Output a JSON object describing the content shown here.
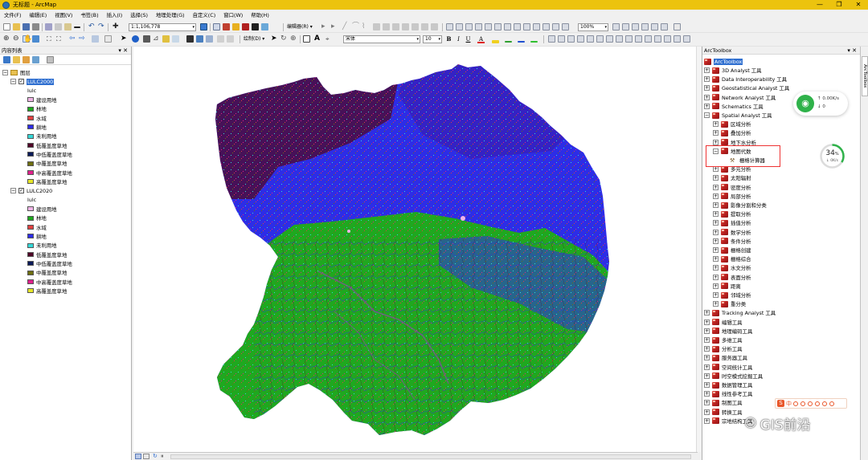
{
  "window": {
    "title": "无标题 - ArcMap",
    "minimize": "—",
    "maximize": "❐",
    "close": "✕"
  },
  "menu": [
    "文件(F)",
    "编辑(E)",
    "视图(V)",
    "书签(B)",
    "插入(I)",
    "选择(S)",
    "地理处理(G)",
    "自定义(C)",
    "窗口(W)",
    "帮助(H)"
  ],
  "toolbar": {
    "scale": "1:1,106,778",
    "editor_label": "编辑器(R) ▾",
    "zoom": "100%",
    "draw_label": "绘制(D) ▾",
    "font": "宋体",
    "font_size": "10",
    "bold": "B",
    "italic": "I",
    "underline": "U",
    "font_color_letter": "A"
  },
  "toc": {
    "title": "内容列表",
    "pin": "▾ ✕",
    "layers_group": "图层",
    "layers": [
      {
        "name": "LULC2000",
        "field": "lulc",
        "classes": [
          {
            "label": "建设用地",
            "color": "#f0b4e6"
          },
          {
            "label": "林地",
            "color": "#1fa81f"
          },
          {
            "label": "水域",
            "color": "#e04040"
          },
          {
            "label": "耕地",
            "color": "#2d2de6"
          },
          {
            "label": "未利用地",
            "color": "#35d8d8"
          },
          {
            "label": "低覆盖度草地",
            "color": "#500828"
          },
          {
            "label": "中低覆盖度草地",
            "color": "#0a1a58"
          },
          {
            "label": "中覆盖度草地",
            "color": "#6e6e10"
          },
          {
            "label": "中高覆盖度草地",
            "color": "#e0208c"
          },
          {
            "label": "高覆盖度草地",
            "color": "#e6e628"
          }
        ]
      },
      {
        "name": "LULC2020",
        "field": "lulc",
        "classes": [
          {
            "label": "建设用地",
            "color": "#f0b4e6"
          },
          {
            "label": "林地",
            "color": "#1fa81f"
          },
          {
            "label": "水域",
            "color": "#e04040"
          },
          {
            "label": "耕地",
            "color": "#2d2de6"
          },
          {
            "label": "未利用地",
            "color": "#35d8d8"
          },
          {
            "label": "低覆盖度草地",
            "color": "#500828"
          },
          {
            "label": "中低覆盖度草地",
            "color": "#0a1a58"
          },
          {
            "label": "中覆盖度草地",
            "color": "#6e6e10"
          },
          {
            "label": "中高覆盖度草地",
            "color": "#e0208c"
          },
          {
            "label": "高覆盖度草地",
            "color": "#e6e628"
          }
        ]
      }
    ]
  },
  "toolbox": {
    "title": "ArcToolbox",
    "pin": "▾ ✕",
    "root": "ArcToolbox",
    "items": [
      {
        "label": "3D Analyst 工具",
        "level": 0,
        "kind": "box",
        "expanded": false
      },
      {
        "label": "Data Interoperability 工具",
        "level": 0,
        "kind": "box",
        "expanded": false
      },
      {
        "label": "Geostatistical Analyst 工具",
        "level": 0,
        "kind": "box",
        "expanded": false
      },
      {
        "label": "Network Analyst 工具",
        "level": 0,
        "kind": "box",
        "expanded": false
      },
      {
        "label": "Schematics 工具",
        "level": 0,
        "kind": "box",
        "expanded": false
      },
      {
        "label": "Spatial Analyst 工具",
        "level": 0,
        "kind": "box",
        "expanded": true
      },
      {
        "label": "区域分析",
        "level": 1,
        "kind": "box",
        "expanded": false
      },
      {
        "label": "叠加分析",
        "level": 1,
        "kind": "box",
        "expanded": false
      },
      {
        "label": "地下水分析",
        "level": 1,
        "kind": "box",
        "expanded": false
      },
      {
        "label": "地图代数",
        "level": 1,
        "kind": "box",
        "expanded": true
      },
      {
        "label": "栅格计算器",
        "level": 2,
        "kind": "tool",
        "expanded": false
      },
      {
        "label": "多元分析",
        "level": 1,
        "kind": "box",
        "expanded": false
      },
      {
        "label": "太阳辐射",
        "level": 1,
        "kind": "box",
        "expanded": false
      },
      {
        "label": "密度分析",
        "level": 1,
        "kind": "box",
        "expanded": false
      },
      {
        "label": "局部分析",
        "level": 1,
        "kind": "box",
        "expanded": false
      },
      {
        "label": "影像分割和分类",
        "level": 1,
        "kind": "box",
        "expanded": false
      },
      {
        "label": "提取分析",
        "level": 1,
        "kind": "box",
        "expanded": false
      },
      {
        "label": "插值分析",
        "level": 1,
        "kind": "box",
        "expanded": false
      },
      {
        "label": "数学分析",
        "level": 1,
        "kind": "box",
        "expanded": false
      },
      {
        "label": "条件分析",
        "level": 1,
        "kind": "box",
        "expanded": false
      },
      {
        "label": "栅格创建",
        "level": 1,
        "kind": "box",
        "expanded": false
      },
      {
        "label": "栅格综合",
        "level": 1,
        "kind": "box",
        "expanded": false
      },
      {
        "label": "水文分析",
        "level": 1,
        "kind": "box",
        "expanded": false
      },
      {
        "label": "表面分析",
        "level": 1,
        "kind": "box",
        "expanded": false
      },
      {
        "label": "距离",
        "level": 1,
        "kind": "box",
        "expanded": false
      },
      {
        "label": "邻域分析",
        "level": 1,
        "kind": "box",
        "expanded": false
      },
      {
        "label": "重分类",
        "level": 1,
        "kind": "box",
        "expanded": false
      },
      {
        "label": "Tracking Analyst 工具",
        "level": 0,
        "kind": "box",
        "expanded": false
      },
      {
        "label": "编辑工具",
        "level": 0,
        "kind": "box",
        "expanded": false
      },
      {
        "label": "地理编码工具",
        "level": 0,
        "kind": "box",
        "expanded": false
      },
      {
        "label": "多维工具",
        "level": 0,
        "kind": "box",
        "expanded": false
      },
      {
        "label": "分析工具",
        "level": 0,
        "kind": "box",
        "expanded": false
      },
      {
        "label": "服务器工具",
        "level": 0,
        "kind": "box",
        "expanded": false
      },
      {
        "label": "空间统计工具",
        "level": 0,
        "kind": "box",
        "expanded": false
      },
      {
        "label": "时空模式挖掘工具",
        "level": 0,
        "kind": "box",
        "expanded": false
      },
      {
        "label": "数据管理工具",
        "level": 0,
        "kind": "box",
        "expanded": false
      },
      {
        "label": "线性参考工具",
        "level": 0,
        "kind": "box",
        "expanded": false
      },
      {
        "label": "制图工具",
        "level": 0,
        "kind": "box",
        "expanded": false
      },
      {
        "label": "转换工具",
        "level": 0,
        "kind": "box",
        "expanded": false
      },
      {
        "label": "宗地结构工具",
        "level": 0,
        "kind": "box",
        "expanded": false
      }
    ]
  },
  "side_tab": "ArcToolbox",
  "overlays": {
    "net_upload": "↑ 0.00K/s",
    "net_download": "↓ 0",
    "cpu_percent": "34",
    "cpu_unit": "%",
    "cpu_speed": "↓ 0K/s",
    "ime_letter": "S",
    "ime_mode": "中",
    "watermark": "GIS前沿"
  },
  "colors": {
    "titlebar": "#ecc30e",
    "selection": "#2f6fd0",
    "highlight_box": "#ee3333",
    "forest": "#1fa81f",
    "cropland": "#2d2de6",
    "low_grass": "#500828"
  }
}
